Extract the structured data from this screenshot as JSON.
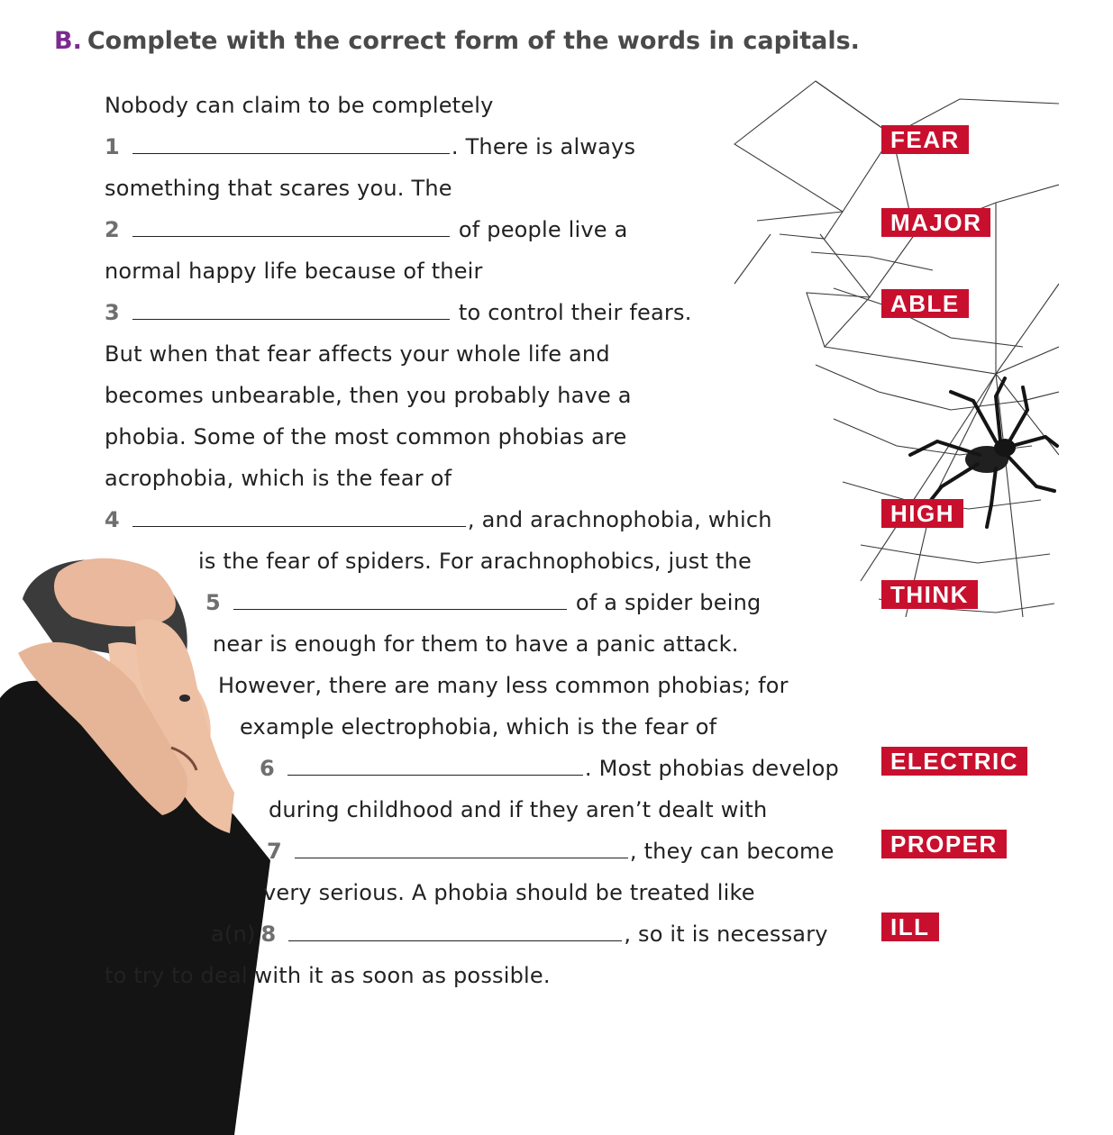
{
  "exercise": {
    "letter": "B.",
    "instruction": "Complete with the correct form of the words in capitals."
  },
  "text_lines": {
    "l1": "Nobody can claim to be completely",
    "l2_num": "1",
    "l2_after": ". There is always",
    "l3": "something that scares you. The",
    "l4_num": "2",
    "l4_after": "of people live a",
    "l5": "normal happy life because of their",
    "l6_num": "3",
    "l6_after": "to control their fears.",
    "l7": "But when that fear affects your whole life and",
    "l8": "becomes unbearable, then you probably have a",
    "l9": "phobia. Some of the most common phobias are",
    "l10": "acrophobia, which is the fear of",
    "l11_num": "4",
    "l11_after": ", and arachnophobia, which",
    "l12": "is the fear of spiders. For arachnophobics, just the",
    "l13_num": "5",
    "l13_after": "of a spider being",
    "l14": "near is enough for them to have a panic attack.",
    "l15": "However, there are many less common phobias; for",
    "l16": "example electrophobia, which is the fear of",
    "l17_num": "6",
    "l17_after": ". Most phobias develop",
    "l18": "during childhood and if they aren’t dealt with",
    "l19_num": "7",
    "l19_after": ", they can become",
    "l20": "very serious. A phobia should be treated like",
    "l21_pre": "a(n)",
    "l21_num": "8",
    "l21_after": ", so it is necessary",
    "l22": "to try to deal with it as soon as possible."
  },
  "keywords": {
    "k1": "FEAR",
    "k2": "MAJOR",
    "k3": "ABLE",
    "k4": "HIGH",
    "k5": "THINK",
    "k6": "ELECTRIC",
    "k7": "PROPER",
    "k8": "ILL"
  },
  "colors": {
    "keyword_bg": "#c8102e",
    "letter_accent": "#7a2b8f",
    "heading_text": "#4a4a4a"
  }
}
